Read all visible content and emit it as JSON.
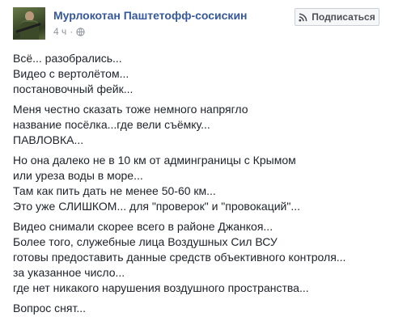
{
  "post": {
    "author": "Мурлокотан Паштетофф-сосискин",
    "time": "4 ч",
    "separator": "·",
    "subscribe_label": "Подписаться",
    "paragraphs": [
      [
        "Всё... разобрались...",
        "Видео с вертолётом...",
        "постановочный фейк..."
      ],
      [
        "Меня честно сказать тоже немного напрягло",
        "название посёлка...где вели съёмку...",
        "ПАВЛОВКА..."
      ],
      [
        "Но она далеко не в 10 км от админграницы с Крымом",
        "или уреза воды в море...",
        "Там как пить дать не менее 50-60 км...",
        "Это уже СЛИШКОМ... для \"проверок\" и \"провокаций\"..."
      ],
      [
        "Видео снимали скорее всего в районе Джанкоя...",
        "Более того, служебные лица Воздушных Сил ВСУ",
        "готовы предоставить данные средств объективного контроля...",
        "за указанное число...",
        "где нет никакого нарушения воздушного пространства..."
      ],
      [
        "Вопрос снят..."
      ]
    ]
  },
  "icons": {
    "avatar": "profile-photo-soldier",
    "privacy": "globe-icon",
    "subscribe": "rss-icon"
  },
  "colors": {
    "author_link": "#365899",
    "meta_text": "#90949c",
    "body_text": "#1d2129",
    "button_bg": "#f6f7f9",
    "button_border": "#ccd0d5"
  }
}
